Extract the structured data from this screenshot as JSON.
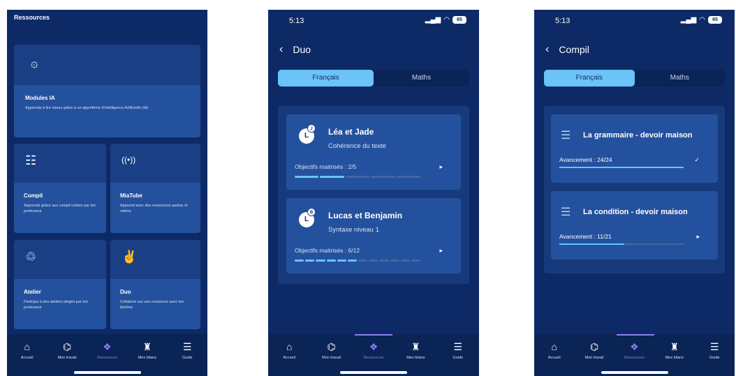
{
  "status": {
    "time": "5:13",
    "battery": "65",
    "signal": "▂▄▆",
    "wifi": "◠"
  },
  "nav": {
    "items": [
      {
        "label": "Accueil",
        "icon": "home-icon",
        "glyph": "⌂"
      },
      {
        "label": "Mon travail",
        "icon": "briefcase-icon",
        "glyph": "⌬"
      },
      {
        "label": "Ressources",
        "icon": "resources-icon",
        "glyph": "❖"
      },
      {
        "label": "Mes bilans",
        "icon": "chart-icon",
        "glyph": "♜"
      },
      {
        "label": "Guide",
        "icon": "guide-icon",
        "glyph": "☰"
      }
    ],
    "active": "Ressources"
  },
  "screen1": {
    "title": "Ressources",
    "modules": {
      "title": "Modules IA",
      "desc": "Apprends à lire mieux grâce à un algorithme d'intelligence Artificielle (IA)",
      "icon": "brain-icon",
      "glyph": "۞"
    },
    "compil": {
      "title": "Compil",
      "desc": "Apprends grâce aux compil créées par ton professeur",
      "icon": "compil-icon",
      "glyph": "☷"
    },
    "miatube": {
      "title": "MiaTube",
      "desc": "Apprend avec des ressources audios et vidéos",
      "icon": "broadcast-icon",
      "glyph": "((•))"
    },
    "atelier": {
      "title": "Atelier",
      "desc": "Participe à des ateliers dirigés par ton professeur",
      "icon": "people-icon",
      "glyph": "♲"
    },
    "duo": {
      "title": "Duo",
      "desc": "Collabore sur une ressource avec ton binôme",
      "icon": "hand-icon",
      "glyph": "✌"
    }
  },
  "screen2": {
    "back": "‹",
    "title": "Duo",
    "tabs": [
      {
        "label": "Français",
        "active": true
      },
      {
        "label": "Maths",
        "active": false
      }
    ],
    "cards": [
      {
        "names": "Léa et Jade",
        "subtitle": "Cohérence du texte",
        "objective": "Objectifs maitrisés : 2/5",
        "mastered": 2,
        "total": 5
      },
      {
        "names": "Lucas et Benjamin",
        "subtitle": "Syntaxe niveau 1",
        "objective": "Objectifs maitrisés : 6/12",
        "mastered": 6,
        "total": 12
      }
    ],
    "play_glyph": "▸"
  },
  "screen3": {
    "back": "‹",
    "title": "Compil",
    "tabs": [
      {
        "label": "Français",
        "active": true
      },
      {
        "label": "Maths",
        "active": false
      }
    ],
    "cards": [
      {
        "title": "La grammaire - devoir maison",
        "progress_text": "Avancement : 24/24",
        "done": 24,
        "total": 24,
        "mark": "✓"
      },
      {
        "title": "La condition - devoir maison",
        "progress_text": "Avancement : 11/21",
        "done": 11,
        "total": 21,
        "mark": "▸"
      }
    ],
    "list_glyph": "☰"
  },
  "colors": {
    "background": "#0e2a66",
    "card": "#24519d",
    "accent": "#6cc3f7",
    "active_nav": "#8f7df0"
  }
}
